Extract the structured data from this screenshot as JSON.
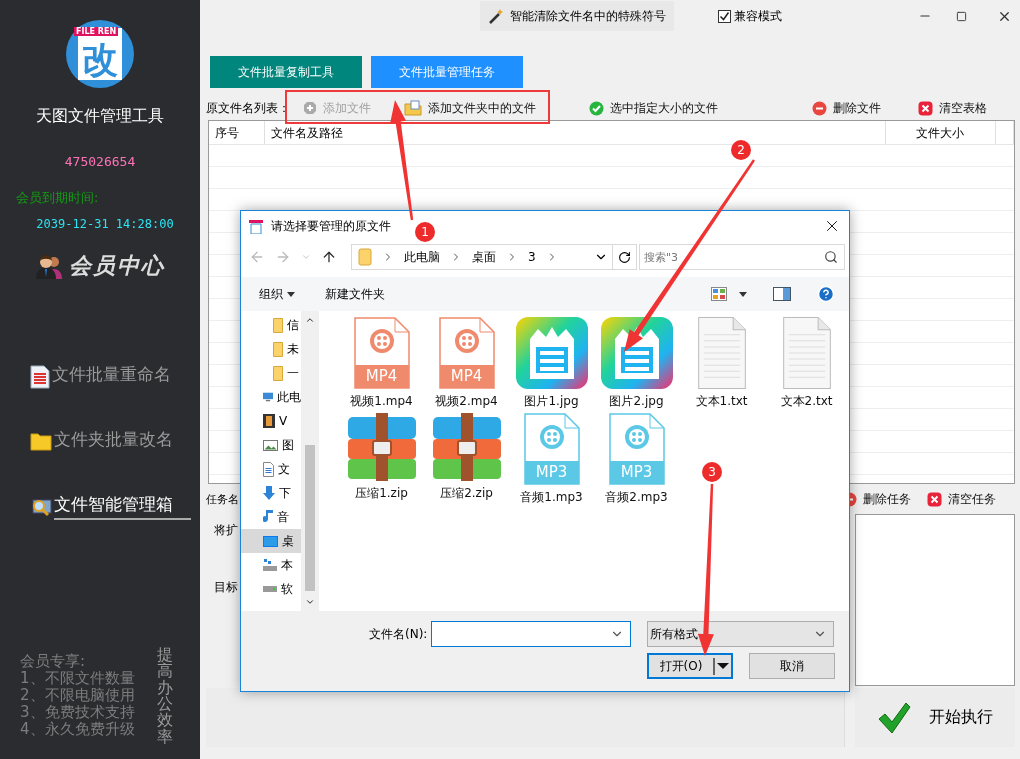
{
  "sidebar": {
    "logo": {
      "badge": "FILE REN",
      "glyph": "改"
    },
    "app_name": "天图文件管理工具",
    "qq": "475026654",
    "expiry_label": "会员到期时间:",
    "expiry": "2039-12-31 14:28:00",
    "member_center": "会员中心",
    "nav": [
      {
        "label": "文件批量重命名",
        "kind": "list",
        "selected": false
      },
      {
        "label": "文件夹批量改名",
        "kind": "folder",
        "selected": false
      },
      {
        "label": "文件智能管理箱",
        "kind": "search",
        "selected": true
      }
    ],
    "perks_title": "会员专享:",
    "perks": [
      "1、不限文件数量",
      "2、不限电脑使用",
      "3、免费技术支持",
      "4、永久免费升级"
    ],
    "slogan": "提高办公效率"
  },
  "header": {
    "tool": "智能清除文件名中的特殊符号",
    "compat": {
      "label": "兼容模式",
      "checked": true
    }
  },
  "tabs": [
    {
      "label": "文件批量复制工具",
      "selected": false
    },
    {
      "label": "文件批量管理任务",
      "selected": true
    }
  ],
  "file_toolbar": {
    "label": "原文件名列表：",
    "actions": [
      {
        "label": "添加文件",
        "kind": "add",
        "disabled": true
      },
      {
        "label": "添加文件夹中的文件",
        "kind": "folder",
        "disabled": false
      },
      {
        "label": "选中指定大小的文件",
        "kind": "check",
        "disabled": false
      },
      {
        "label": "删除文件",
        "kind": "minus",
        "disabled": false
      },
      {
        "label": "清空表格",
        "kind": "clear",
        "disabled": false
      }
    ]
  },
  "file_table": {
    "columns": [
      "序号",
      "文件名及路径",
      "文件大小"
    ]
  },
  "task_section": {
    "label": "任务名",
    "fields": [
      "将扩",
      "目标"
    ],
    "actions": [
      {
        "label": "删除任务",
        "kind": "minus"
      },
      {
        "label": "清空任务",
        "kind": "clear"
      }
    ]
  },
  "start_button": "开始执行",
  "dialog": {
    "title": "请选择要管理的原文件",
    "path": [
      "此电脑",
      "桌面",
      "3"
    ],
    "search": {
      "placeholder": "搜索\"3"
    },
    "toolbar": {
      "organize": "组织",
      "new_folder": "新建文件夹"
    },
    "nav": [
      {
        "label": "信",
        "kind": "folder",
        "selected": false
      },
      {
        "label": "未",
        "kind": "folder",
        "selected": false
      },
      {
        "label": "一",
        "kind": "folder",
        "selected": false
      },
      {
        "label": "此电",
        "kind": "pc",
        "selected": false
      },
      {
        "label": "V",
        "kind": "video",
        "selected": false
      },
      {
        "label": "图",
        "kind": "image",
        "selected": false
      },
      {
        "label": "文",
        "kind": "doc",
        "selected": false
      },
      {
        "label": "下",
        "kind": "download",
        "selected": false
      },
      {
        "label": "音",
        "kind": "music",
        "selected": false
      },
      {
        "label": "桌",
        "kind": "desktop",
        "selected": true
      },
      {
        "label": "本",
        "kind": "netdrive",
        "selected": false
      },
      {
        "label": "软",
        "kind": "drive",
        "selected": false
      }
    ],
    "files": [
      {
        "name": "视频1.mp4",
        "kind": "video",
        "badge": "MP4"
      },
      {
        "name": "视频2.mp4",
        "kind": "video",
        "badge": "MP4"
      },
      {
        "name": "图片1.jpg",
        "kind": "image"
      },
      {
        "name": "图片2.jpg",
        "kind": "image"
      },
      {
        "name": "文本1.txt",
        "kind": "text"
      },
      {
        "name": "文本2.txt",
        "kind": "text"
      },
      {
        "name": "压缩1.zip",
        "kind": "archive"
      },
      {
        "name": "压缩2.zip",
        "kind": "archive"
      },
      {
        "name": "音频1.mp3",
        "kind": "audio",
        "badge": "MP3"
      },
      {
        "name": "音频2.mp3",
        "kind": "audio",
        "badge": "MP3"
      }
    ],
    "filename_label": "文件名(N):",
    "filter": "所有格式",
    "open": "打开(O)",
    "cancel": "取消"
  },
  "annotations": [
    {
      "label": "1"
    },
    {
      "label": "2"
    },
    {
      "label": "3"
    }
  ]
}
